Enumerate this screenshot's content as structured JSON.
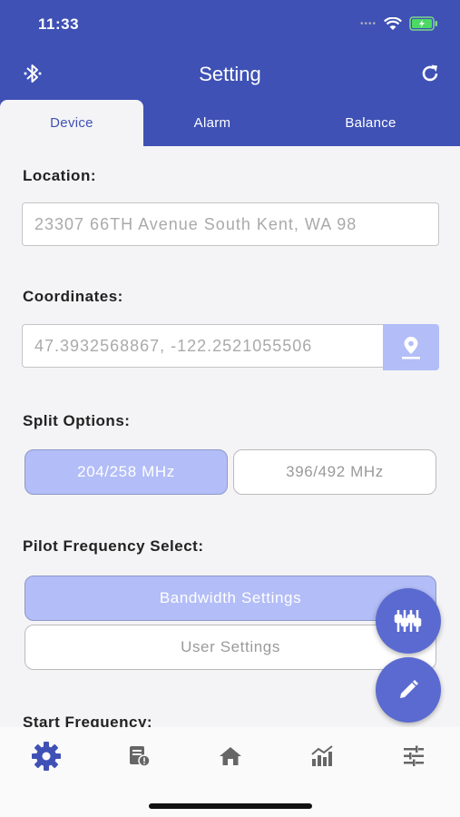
{
  "status_bar": {
    "time": "11:33"
  },
  "header": {
    "title": "Setting"
  },
  "tabs": [
    {
      "label": "Device",
      "active": true
    },
    {
      "label": "Alarm",
      "active": false
    },
    {
      "label": "Balance",
      "active": false
    }
  ],
  "location": {
    "label": "Location:",
    "value": "23307 66TH Avenue South Kent, WA 98"
  },
  "coordinates": {
    "label": "Coordinates:",
    "value": "47.3932568867, -122.2521055506"
  },
  "split": {
    "label": "Split Options:",
    "options": [
      "204/258 MHz",
      "396/492 MHz"
    ],
    "selected": "204/258 MHz"
  },
  "pilot": {
    "label": "Pilot Frequency Select:",
    "options": [
      "Bandwidth Settings",
      "User Settings"
    ],
    "selected": "Bandwidth Settings"
  },
  "start_frequency": {
    "label": "Start Frequency:"
  },
  "bottom_nav": [
    "settings-icon",
    "device-info-icon",
    "home-icon",
    "chart-icon",
    "sliders-icon"
  ],
  "colors": {
    "primary": "#3f51b5",
    "accent_light": "#b3bdf7",
    "fab": "#5a6ad0"
  }
}
